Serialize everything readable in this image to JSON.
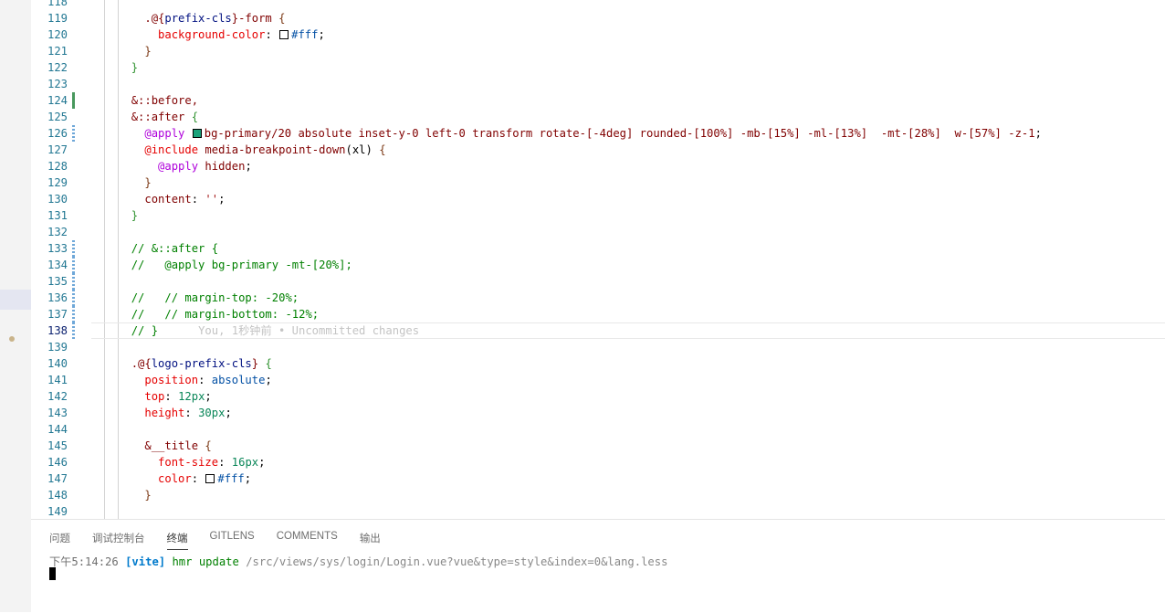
{
  "editor": {
    "lines": [
      {
        "n": "118",
        "code": []
      },
      {
        "n": "119",
        "code": [
          [
            "    ",
            "plain"
          ],
          [
            ".@{",
            "selector"
          ],
          [
            "prefix-cls",
            "var"
          ],
          [
            "}-form ",
            "selector"
          ],
          [
            "{",
            "brace2"
          ]
        ]
      },
      {
        "n": "120",
        "code": [
          [
            "      ",
            "plain"
          ],
          [
            "background-color",
            "prop"
          ],
          [
            ": ",
            "plain"
          ],
          [
            "@swatch:#fff",
            ""
          ],
          [
            "#fff",
            "value"
          ],
          [
            ";",
            "plain"
          ]
        ]
      },
      {
        "n": "121",
        "code": [
          [
            "    ",
            "plain"
          ],
          [
            "}",
            "brace2"
          ]
        ]
      },
      {
        "n": "122",
        "code": [
          [
            "  ",
            "plain"
          ],
          [
            "}",
            "brace"
          ]
        ]
      },
      {
        "n": "123",
        "code": []
      },
      {
        "n": "124",
        "mark": "added",
        "code": [
          [
            "  ",
            "plain"
          ],
          [
            "&::before,",
            "selector"
          ]
        ]
      },
      {
        "n": "125",
        "code": [
          [
            "  ",
            "plain"
          ],
          [
            "&::after ",
            "selector"
          ],
          [
            "{",
            "brace"
          ]
        ]
      },
      {
        "n": "126",
        "mark": "mod",
        "code": [
          [
            "    ",
            "plain"
          ],
          [
            "@apply ",
            "at"
          ],
          [
            "@swatch:#1aa27a",
            ""
          ],
          [
            "bg-primary/20 absolute inset-y-0 left-0 transform rotate-[-4deg] rounded-[100%] -mb-[15%] -ml-[13%]  -mt-[28%]  w-[57%] -z-1",
            "selector"
          ],
          [
            ";",
            "plain"
          ]
        ]
      },
      {
        "n": "127",
        "code": [
          [
            "    ",
            "plain"
          ],
          [
            "@include ",
            "prop"
          ],
          [
            "media-breakpoint-down",
            "selector"
          ],
          [
            "(",
            "plain"
          ],
          [
            "xl",
            "plain"
          ],
          [
            ") ",
            "plain"
          ],
          [
            "{",
            "brace2"
          ]
        ]
      },
      {
        "n": "128",
        "code": [
          [
            "      ",
            "plain"
          ],
          [
            "@apply ",
            "at"
          ],
          [
            "hidden",
            "selector"
          ],
          [
            ";",
            "plain"
          ]
        ]
      },
      {
        "n": "129",
        "code": [
          [
            "    ",
            "plain"
          ],
          [
            "}",
            "brace2"
          ]
        ]
      },
      {
        "n": "130",
        "code": [
          [
            "    ",
            "plain"
          ],
          [
            "content",
            "selector"
          ],
          [
            ": ",
            "plain"
          ],
          [
            "''",
            "string"
          ],
          [
            ";",
            "plain"
          ]
        ]
      },
      {
        "n": "131",
        "code": [
          [
            "  ",
            "plain"
          ],
          [
            "}",
            "brace"
          ]
        ]
      },
      {
        "n": "132",
        "code": []
      },
      {
        "n": "133",
        "mark": "mod",
        "code": [
          [
            "  ",
            "plain"
          ],
          [
            "// &::after {",
            "comment"
          ]
        ]
      },
      {
        "n": "134",
        "mark": "mod",
        "code": [
          [
            "  ",
            "plain"
          ],
          [
            "//   @apply bg-primary -mt-[20%];",
            "comment"
          ]
        ]
      },
      {
        "n": "135",
        "mark": "mod",
        "code": []
      },
      {
        "n": "136",
        "mark": "mod",
        "code": [
          [
            "  ",
            "plain"
          ],
          [
            "//   // margin-top: -20%;",
            "comment"
          ]
        ]
      },
      {
        "n": "137",
        "mark": "mod",
        "code": [
          [
            "  ",
            "plain"
          ],
          [
            "//   // margin-bottom: -12%;",
            "comment"
          ]
        ]
      },
      {
        "n": "138",
        "mark": "mod",
        "current": true,
        "code": [
          [
            "  ",
            "plain"
          ],
          [
            "// }",
            "comment"
          ],
          [
            "      You, 1秒钟前 • Uncommitted changes",
            "ghost"
          ]
        ]
      },
      {
        "n": "139",
        "code": []
      },
      {
        "n": "140",
        "code": [
          [
            "  ",
            "plain"
          ],
          [
            ".@{",
            "selector"
          ],
          [
            "logo-prefix-cls",
            "var"
          ],
          [
            "} ",
            "selector"
          ],
          [
            "{",
            "brace"
          ]
        ]
      },
      {
        "n": "141",
        "code": [
          [
            "    ",
            "plain"
          ],
          [
            "position",
            "prop"
          ],
          [
            ": ",
            "plain"
          ],
          [
            "absolute",
            "value"
          ],
          [
            ";",
            "plain"
          ]
        ]
      },
      {
        "n": "142",
        "code": [
          [
            "    ",
            "plain"
          ],
          [
            "top",
            "prop"
          ],
          [
            ": ",
            "plain"
          ],
          [
            "12px",
            "num"
          ],
          [
            ";",
            "plain"
          ]
        ]
      },
      {
        "n": "143",
        "code": [
          [
            "    ",
            "plain"
          ],
          [
            "height",
            "prop"
          ],
          [
            ": ",
            "plain"
          ],
          [
            "30px",
            "num"
          ],
          [
            ";",
            "plain"
          ]
        ]
      },
      {
        "n": "144",
        "code": []
      },
      {
        "n": "145",
        "code": [
          [
            "    ",
            "plain"
          ],
          [
            "&__title ",
            "selector"
          ],
          [
            "{",
            "brace2"
          ]
        ]
      },
      {
        "n": "146",
        "code": [
          [
            "      ",
            "plain"
          ],
          [
            "font-size",
            "prop"
          ],
          [
            ": ",
            "plain"
          ],
          [
            "16px",
            "num"
          ],
          [
            ";",
            "plain"
          ]
        ]
      },
      {
        "n": "147",
        "code": [
          [
            "      ",
            "plain"
          ],
          [
            "color",
            "prop"
          ],
          [
            ": ",
            "plain"
          ],
          [
            "@swatch:#fff",
            ""
          ],
          [
            "#fff",
            "value"
          ],
          [
            ";",
            "plain"
          ]
        ]
      },
      {
        "n": "148",
        "code": [
          [
            "    ",
            "plain"
          ],
          [
            "}",
            "brace2"
          ]
        ]
      },
      {
        "n": "149",
        "code": []
      }
    ]
  },
  "panel": {
    "tabs": [
      {
        "label": "问题",
        "active": false
      },
      {
        "label": "调试控制台",
        "active": false
      },
      {
        "label": "终端",
        "active": true
      },
      {
        "label": "GITLENS",
        "active": false
      },
      {
        "label": "COMMENTS",
        "active": false
      },
      {
        "label": "输出",
        "active": false
      }
    ],
    "terminal": {
      "time": "下午5:14:26",
      "tag": "[vite]",
      "command": "hmr update",
      "path": "/src/views/sys/login/Login.vue?vue&type=style&index=0&lang.less"
    }
  },
  "colors": {
    "line_number": "#237893",
    "added": "#48985d",
    "modified": "#6ea7d8"
  }
}
